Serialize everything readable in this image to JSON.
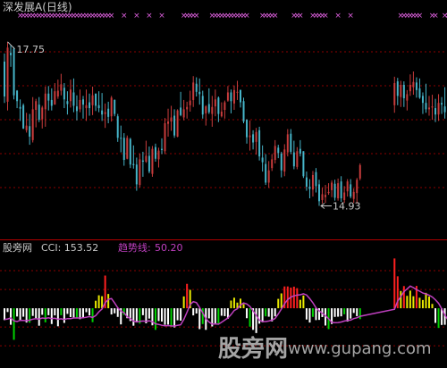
{
  "colors": {
    "background": "#000000",
    "up": "#c83c3c",
    "down": "#46b4c8",
    "grid": "#8b0000",
    "text": "#c8c8c8",
    "marker": "#e060e0",
    "trend": "#c040c0",
    "cci_white": "#ffffff",
    "cci_green": "#00d000",
    "cci_yellow": "#e8e800",
    "cci_red": "#ff2020"
  },
  "main": {
    "title": "深发展A(日线)",
    "high_label": "17.75",
    "low_label": "14.93",
    "marker_glyph": "×"
  },
  "sub": {
    "name": "股旁网",
    "cci_text": "CCI: 153.52",
    "trend_name": "趋势线:",
    "trend_value": "50.20"
  },
  "watermark": {
    "cn": "股旁网",
    "url": "www.gupang.com"
  },
  "chart_data": [
    {
      "type": "candlestick",
      "title": "深发展A(日线)",
      "high": 17.75,
      "low": 14.93,
      "ylim": [
        14.6,
        18.1
      ],
      "gap_after_index": 113,
      "marker_days": [
        5,
        6,
        7,
        8,
        9,
        10,
        11,
        12,
        13,
        14,
        15,
        16,
        17,
        18,
        19,
        20,
        21,
        22,
        23,
        24,
        25,
        26,
        27,
        28,
        29,
        30,
        31,
        32,
        33,
        34,
        38,
        42,
        46,
        50,
        57,
        58,
        59,
        60,
        61,
        66,
        67,
        68,
        69,
        70,
        71,
        72,
        73,
        74,
        75,
        76,
        77,
        82,
        83,
        84,
        85,
        86,
        92,
        93,
        94,
        98,
        99,
        100,
        101,
        102,
        106,
        110,
        116,
        117,
        118,
        119,
        120,
        121,
        122,
        126,
        127,
        130,
        131,
        132,
        133
      ],
      "candles": [
        [
          17.41,
          17.55,
          16.7,
          16.81
        ],
        [
          16.72,
          17.75,
          16.57,
          17.65
        ],
        [
          17.56,
          17.69,
          17.32,
          17.52
        ],
        [
          17.63,
          17.66,
          16.76,
          16.83
        ],
        [
          16.91,
          16.92,
          16.61,
          16.73
        ],
        [
          16.63,
          16.76,
          16.39,
          16.6
        ],
        [
          16.66,
          16.69,
          16.25,
          16.26
        ],
        [
          16.23,
          16.53,
          16.19,
          16.31
        ],
        [
          16.3,
          16.51,
          15.98,
          16.12
        ],
        [
          16.06,
          16.8,
          16.02,
          16.59
        ],
        [
          16.58,
          16.77,
          16.28,
          16.73
        ],
        [
          16.67,
          16.8,
          16.37,
          16.41
        ],
        [
          16.42,
          16.65,
          16.26,
          16.62
        ],
        [
          16.59,
          16.98,
          16.29,
          16.86
        ],
        [
          16.86,
          16.99,
          16.57,
          16.74
        ],
        [
          16.75,
          16.95,
          16.57,
          16.65
        ],
        [
          16.67,
          17.04,
          16.67,
          16.9
        ],
        [
          16.81,
          17.1,
          16.77,
          16.91
        ],
        [
          16.91,
          17.2,
          16.83,
          17.02
        ],
        [
          16.96,
          17.04,
          16.61,
          16.76
        ],
        [
          16.73,
          16.9,
          16.5,
          16.68
        ],
        [
          16.73,
          17.1,
          16.62,
          16.93
        ],
        [
          16.88,
          17.12,
          16.54,
          16.65
        ],
        [
          16.64,
          16.83,
          16.4,
          16.56
        ],
        [
          16.59,
          16.93,
          16.54,
          16.75
        ],
        [
          16.76,
          16.82,
          16.43,
          16.67
        ],
        [
          16.61,
          16.93,
          16.39,
          16.66
        ],
        [
          16.71,
          16.86,
          16.48,
          16.61
        ],
        [
          16.66,
          16.98,
          16.49,
          16.83
        ],
        [
          16.86,
          16.86,
          16.56,
          16.65
        ],
        [
          16.66,
          16.9,
          16.54,
          16.61
        ],
        [
          16.57,
          16.87,
          16.39,
          16.5
        ],
        [
          16.51,
          16.69,
          16.27,
          16.54
        ],
        [
          16.6,
          16.72,
          16.35,
          16.46
        ],
        [
          16.47,
          16.82,
          16.38,
          16.79
        ],
        [
          16.75,
          16.76,
          16.47,
          16.51
        ],
        [
          16.47,
          16.51,
          16.03,
          16.1
        ],
        [
          16.1,
          16.31,
          15.85,
          16.09
        ],
        [
          16.1,
          16.18,
          15.62,
          15.72
        ],
        [
          15.74,
          16.14,
          15.73,
          16.1
        ],
        [
          16.08,
          16.1,
          15.58,
          15.64
        ],
        [
          15.65,
          15.97,
          15.57,
          15.63
        ],
        [
          15.64,
          15.76,
          15.19,
          15.3
        ],
        [
          15.29,
          15.83,
          15.25,
          15.73
        ],
        [
          15.71,
          15.86,
          15.43,
          15.69
        ],
        [
          15.69,
          16.05,
          15.67,
          15.79
        ],
        [
          15.79,
          15.95,
          15.49,
          15.52
        ],
        [
          15.48,
          15.96,
          15.43,
          15.91
        ],
        [
          15.94,
          16.0,
          15.69,
          15.74
        ],
        [
          15.73,
          15.93,
          15.59,
          15.88
        ],
        [
          15.91,
          16.09,
          15.82,
          15.89
        ],
        [
          15.87,
          16.44,
          15.82,
          16.35
        ],
        [
          16.34,
          16.6,
          16.12,
          16.38
        ],
        [
          16.38,
          16.65,
          16.22,
          16.45
        ],
        [
          16.48,
          16.59,
          16.1,
          16.14
        ],
        [
          16.12,
          16.59,
          16.11,
          16.57
        ],
        [
          16.62,
          16.89,
          16.47,
          16.49
        ],
        [
          16.45,
          16.75,
          16.4,
          16.59
        ],
        [
          16.59,
          16.72,
          16.43,
          16.63
        ],
        [
          16.66,
          16.91,
          16.55,
          16.74
        ],
        [
          16.75,
          17.16,
          16.63,
          17.05
        ],
        [
          17.03,
          17.14,
          16.81,
          16.89
        ],
        [
          16.89,
          17.12,
          16.67,
          16.85
        ],
        [
          16.82,
          16.91,
          16.43,
          16.5
        ],
        [
          16.52,
          16.66,
          16.31,
          16.64
        ],
        [
          16.68,
          16.95,
          16.51,
          16.54
        ],
        [
          16.51,
          16.82,
          16.29,
          16.63
        ],
        [
          16.64,
          16.93,
          16.47,
          16.76
        ],
        [
          16.79,
          16.81,
          16.37,
          16.51
        ],
        [
          16.47,
          16.71,
          16.45,
          16.55
        ],
        [
          16.58,
          16.74,
          16.43,
          16.71
        ],
        [
          16.74,
          16.99,
          16.72,
          16.88
        ],
        [
          16.88,
          16.93,
          16.52,
          16.73
        ],
        [
          16.69,
          17.0,
          16.58,
          16.92
        ],
        [
          16.88,
          17.08,
          16.75,
          16.89
        ],
        [
          16.92,
          16.93,
          16.62,
          16.71
        ],
        [
          16.73,
          16.79,
          16.35,
          16.38
        ],
        [
          16.41,
          16.42,
          16.0,
          16.11
        ],
        [
          16.11,
          16.4,
          15.88,
          16.14
        ],
        [
          16.16,
          16.23,
          15.9,
          16.02
        ],
        [
          16.03,
          16.27,
          15.81,
          16.2
        ],
        [
          16.23,
          16.29,
          15.71,
          15.78
        ],
        [
          15.76,
          15.97,
          15.52,
          15.68
        ],
        [
          15.65,
          15.82,
          15.29,
          15.33
        ],
        [
          15.33,
          15.7,
          15.24,
          15.54
        ],
        [
          15.58,
          15.82,
          15.53,
          15.73
        ],
        [
          15.72,
          16.06,
          15.66,
          15.96
        ],
        [
          15.93,
          15.98,
          15.75,
          15.84
        ],
        [
          15.83,
          15.86,
          15.42,
          15.54
        ],
        [
          15.52,
          15.99,
          15.44,
          15.9
        ],
        [
          15.85,
          16.25,
          15.78,
          16.16
        ],
        [
          16.17,
          16.25,
          15.82,
          15.86
        ],
        [
          15.85,
          16.05,
          15.56,
          15.61
        ],
        [
          15.6,
          15.94,
          15.56,
          15.87
        ],
        [
          15.91,
          16.06,
          15.78,
          15.83
        ],
        [
          15.87,
          15.87,
          15.41,
          15.44
        ],
        [
          15.42,
          15.52,
          15.19,
          15.26
        ],
        [
          15.26,
          15.39,
          15.06,
          15.22
        ],
        [
          15.21,
          15.53,
          15.09,
          15.46
        ],
        [
          15.51,
          15.58,
          15.16,
          15.27
        ],
        [
          15.3,
          15.38,
          14.93,
          15.01
        ],
        [
          15.03,
          15.24,
          14.97,
          15.13
        ],
        [
          15.08,
          15.29,
          14.98,
          15.12
        ],
        [
          15.15,
          15.32,
          15.12,
          15.17
        ],
        [
          15.2,
          15.37,
          15.08,
          15.33
        ],
        [
          15.31,
          15.38,
          15.02,
          15.07
        ],
        [
          15.06,
          15.4,
          15.02,
          15.32
        ],
        [
          15.35,
          15.44,
          15.0,
          15.06
        ],
        [
          15.03,
          15.27,
          14.98,
          15.16
        ],
        [
          15.18,
          15.39,
          15.09,
          15.35
        ],
        [
          15.3,
          15.39,
          15.06,
          15.09
        ],
        [
          15.05,
          15.23,
          14.98,
          15.17
        ],
        [
          15.15,
          15.41,
          14.97,
          15.38
        ],
        [
          15.4,
          15.66,
          15.37,
          15.63
        ],
        [
          16.66,
          17.15,
          16.53,
          17.04
        ],
        [
          17.07,
          17.13,
          16.66,
          16.82
        ],
        [
          16.8,
          17.08,
          16.63,
          17.01
        ],
        [
          17.01,
          17.07,
          16.63,
          16.78
        ],
        [
          16.74,
          16.92,
          16.57,
          16.85
        ],
        [
          16.9,
          17.19,
          16.82,
          17.01
        ],
        [
          16.97,
          17.24,
          16.84,
          17.06
        ],
        [
          17.05,
          17.14,
          16.79,
          16.92
        ],
        [
          16.95,
          17.12,
          16.77,
          16.79
        ],
        [
          16.82,
          16.88,
          16.51,
          16.7
        ],
        [
          16.7,
          17.03,
          16.53,
          16.59
        ],
        [
          16.59,
          16.82,
          16.48,
          16.62
        ],
        [
          16.62,
          16.84,
          16.41,
          16.64
        ],
        [
          16.61,
          16.77,
          16.37,
          16.5
        ],
        [
          16.5,
          16.85,
          16.39,
          16.7
        ],
        [
          16.7,
          16.8,
          16.51,
          16.67
        ],
        [
          16.64,
          16.97,
          16.43,
          16.54
        ],
        [
          16.54,
          16.93,
          16.52,
          16.83
        ],
        [
          16.83,
          17.24,
          16.74,
          17.17
        ],
        [
          17.15,
          17.4,
          17.03,
          17.22
        ]
      ]
    },
    {
      "type": "bar",
      "title": "股旁网",
      "cci_last": 153.52,
      "trend_last": 50.2,
      "ylim": [
        -280,
        300
      ],
      "cci": [
        -63,
        -20,
        -88,
        -168,
        -44,
        -63,
        -45,
        -76,
        -77,
        -41,
        -53,
        -93,
        -35,
        -75,
        -37,
        -84,
        -38,
        -96,
        -37,
        -78,
        -30,
        -47,
        -49,
        -54,
        -58,
        -51,
        -21,
        -38,
        -74,
        40,
        69,
        64,
        174,
        76,
        -33,
        -27,
        -46,
        -86,
        -36,
        -53,
        -68,
        -93,
        -71,
        -82,
        -37,
        -80,
        -55,
        -91,
        -115,
        -68,
        -71,
        -88,
        -87,
        -98,
        -102,
        -64,
        -66,
        63,
        130,
        98,
        -38,
        -28,
        -111,
        -84,
        -115,
        -54,
        -97,
        -84,
        -80,
        -40,
        -42,
        -56,
        41,
        56,
        30,
        51,
        22,
        -53,
        -98,
        -115,
        -132,
        -82,
        -75,
        -43,
        -45,
        -70,
        -43,
        50,
        79,
        116,
        116,
        110,
        115,
        107,
        45,
        68,
        -60,
        -76,
        -46,
        -63,
        -62,
        -47,
        -92,
        -111,
        -84,
        -46,
        -45,
        -43,
        -32,
        -71,
        -55,
        -25,
        -42,
        -58,
        265,
        170,
        92,
        118,
        66,
        94,
        64,
        119,
        56,
        44,
        82,
        62,
        23,
        -78,
        -105,
        -89,
        -88,
        -59,
        -128,
        -141,
        -117,
        -110,
        -103,
        -61,
        -14,
        -74,
        -28,
        154
      ],
      "trend": [
        -60,
        -57,
        -52,
        -67,
        -71,
        -64,
        -65,
        -66,
        -63,
        -58,
        -55,
        -58,
        -52,
        -54,
        -51,
        -55,
        -53,
        -59,
        -56,
        -60,
        -55,
        -55,
        -52,
        -52,
        -52,
        -51,
        -48,
        -44,
        -49,
        -39,
        -19,
        -4,
        29,
        47,
        52,
        28,
        3,
        -15,
        -24,
        -45,
        -55,
        -68,
        -73,
        -70,
        -68,
        -70,
        -67,
        -72,
        -83,
        -86,
        -91,
        -93,
        -92,
        -94,
        -95,
        -91,
        -88,
        -60,
        -21,
        20,
        35,
        30,
        5,
        -25,
        -56,
        -73,
        -84,
        -83,
        -85,
        -74,
        -63,
        -52,
        -34,
        -12,
        -3,
        17,
        28,
        23,
        9,
        -14,
        -38,
        -63,
        -71,
        -71,
        -68,
        -63,
        -54,
        -31,
        -4,
        24,
        46,
        59,
        66,
        70,
        72,
        77,
        71,
        52,
        29,
        2,
        -14,
        -27,
        -39,
        -56,
        -75,
        -77,
        -76,
        -73,
        -68,
        -65,
        -63,
        -55,
        -51,
        -43,
        -5,
        38,
        62,
        88,
        103,
        118,
        110,
        99,
        91,
        81,
        76,
        69,
        60,
        45,
        26,
        -3,
        -36,
        -62,
        -83,
        -98,
        -115,
        -123,
        -125,
        -121,
        -113,
        -90,
        -72,
        -52,
        50
      ]
    }
  ]
}
